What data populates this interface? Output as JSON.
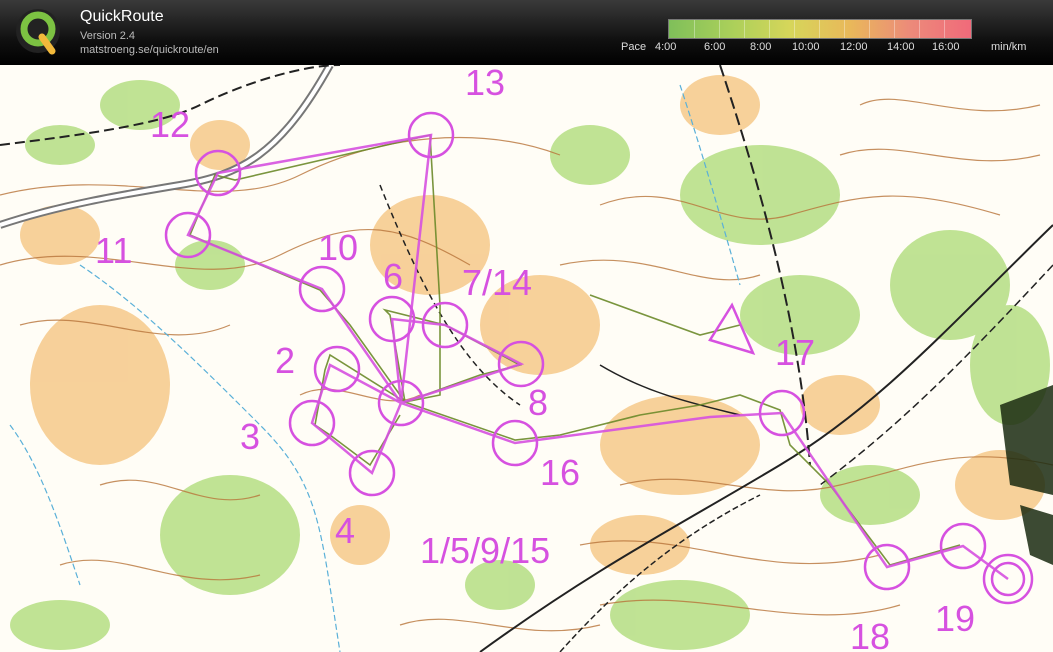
{
  "app": {
    "title": "QuickRoute",
    "version": "Version 2.4",
    "url": "matstroeng.se/quickroute/en"
  },
  "legend": {
    "label": "Pace",
    "ticks": [
      "4:00",
      "6:00",
      "8:00",
      "10:00",
      "12:00",
      "14:00",
      "16:00"
    ],
    "unit": "min/km",
    "colors": [
      "#7fbf5a",
      "#a9cf5a",
      "#d6d65a",
      "#e9b85a",
      "#ec8a7a",
      "#f06a7a"
    ]
  },
  "map": {
    "course_color": "#d651e0",
    "route_color": "#6b8a2a",
    "controls": [
      {
        "label": "1/5/9/15"
      },
      {
        "label": "2"
      },
      {
        "label": "3"
      },
      {
        "label": "4"
      },
      {
        "label": "6"
      },
      {
        "label": "7/14"
      },
      {
        "label": "8"
      },
      {
        "label": "10"
      },
      {
        "label": "11"
      },
      {
        "label": "12"
      },
      {
        "label": "13"
      },
      {
        "label": "16"
      },
      {
        "label": "17"
      },
      {
        "label": "18"
      },
      {
        "label": "19"
      }
    ]
  }
}
